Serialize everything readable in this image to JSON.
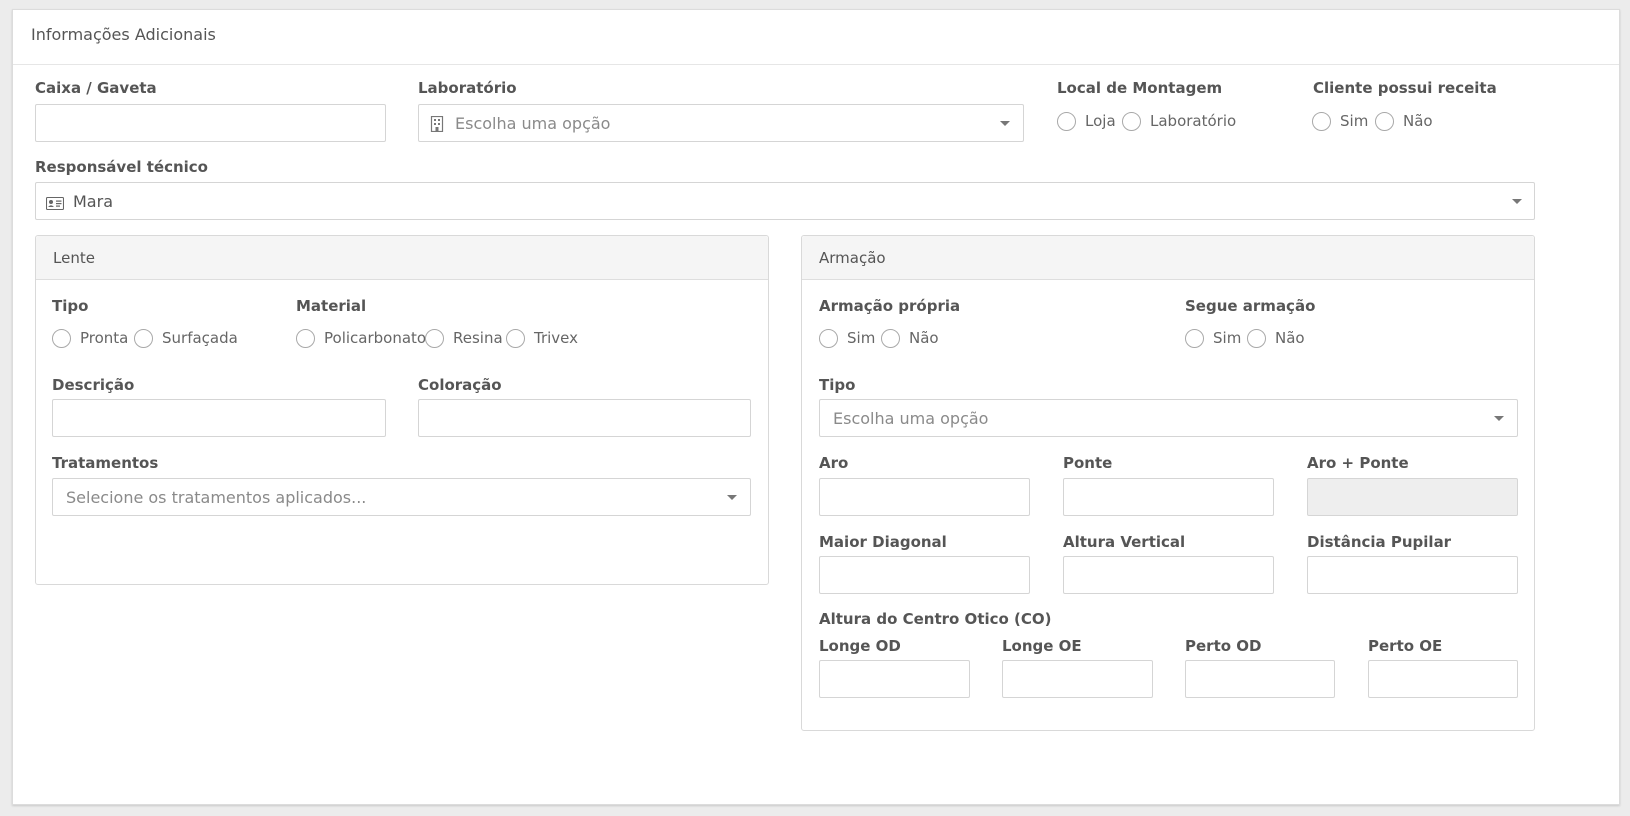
{
  "panel": {
    "title": "Informações Adicionais"
  },
  "top": {
    "caixa_label": "Caixa / Gaveta",
    "laboratorio_label": "Laboratório",
    "laboratorio_placeholder": "Escolha uma opção",
    "local_label": "Local de Montagem",
    "local_options": [
      "Loja",
      "Laboratório"
    ],
    "receita_label": "Cliente possui receita",
    "receita_options": [
      "Sim",
      "Não"
    ],
    "responsavel_label": "Responsável técnico",
    "responsavel_value": "Mara"
  },
  "lente": {
    "title": "Lente",
    "tipo_label": "Tipo",
    "tipo_options": [
      "Pronta",
      "Surfaçada"
    ],
    "material_label": "Material",
    "material_options": [
      "Policarbonato",
      "Resina",
      "Trivex"
    ],
    "descricao_label": "Descrição",
    "coloracao_label": "Coloração",
    "tratamentos_label": "Tratamentos",
    "tratamentos_placeholder": "Selecione os tratamentos aplicados..."
  },
  "armacao": {
    "title": "Armação",
    "propria_label": "Armação própria",
    "propria_options": [
      "Sim",
      "Não"
    ],
    "segue_label": "Segue armação",
    "segue_options": [
      "Sim",
      "Não"
    ],
    "tipo_label": "Tipo",
    "tipo_placeholder": "Escolha uma opção",
    "aro_label": "Aro",
    "ponte_label": "Ponte",
    "aro_ponte_label": "Aro + Ponte",
    "maior_diagonal_label": "Maior Diagonal",
    "altura_vertical_label": "Altura Vertical",
    "distancia_pupilar_label": "Distância Pupilar",
    "centro_otico_label": "Altura do Centro Otico (CO)",
    "longe_od_label": "Longe OD",
    "longe_oe_label": "Longe OE",
    "perto_od_label": "Perto OD",
    "perto_oe_label": "Perto OE"
  },
  "icons": {
    "laboratorio": "building-icon",
    "responsavel": "id-card-icon",
    "dropdown": "caret-down-icon"
  },
  "colors": {
    "border": "#d5d5d5",
    "label": "#555555",
    "placeholder": "#8a8a8a",
    "box_header": "#f5f5f5",
    "disabled_input": "#eeeeee"
  }
}
